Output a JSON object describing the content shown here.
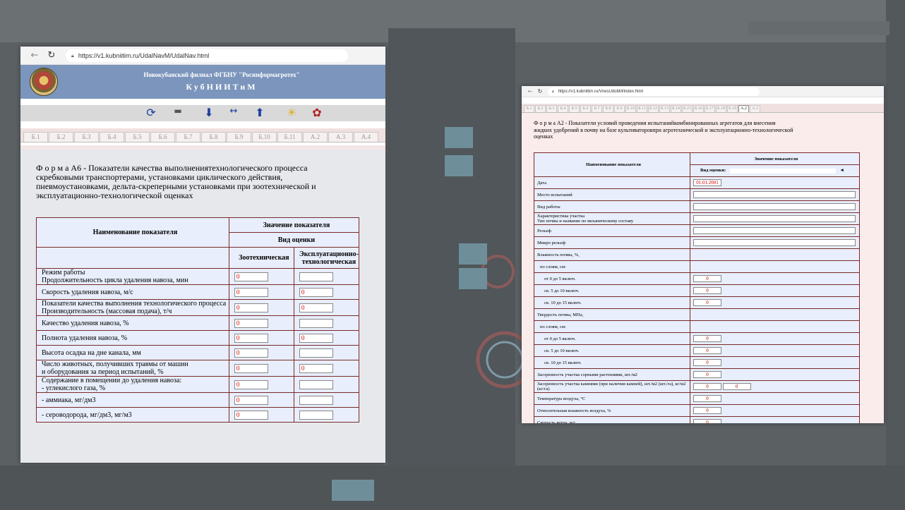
{
  "window_left": {
    "url": "https://v1.kubniitim.ru/UdalNavM/UdalNav.html",
    "header_line1": "Новокубанский филиал ФГБНУ \"Росинформагротех\"",
    "header_line2": "КубНИИТиМ",
    "tabs": [
      "Б.1",
      "Б.2",
      "Б.3",
      "Б.4",
      "Б.5",
      "Б.6",
      "Б.7",
      "Б.8",
      "Б.9",
      "Б.10",
      "Б.11",
      "А.2",
      "А.3",
      "А.4"
    ],
    "form_title": "Ф о р м а А6 - Показатели качества выполнениятехнологического процесса скребковыми транспортерами, установками циклического действия, пневмоустановками, дельта-скреперными установками при зоотехнической и эксплуатационно-технологической оценках",
    "table": {
      "col_name": "Наименование показателя",
      "col_value": "Значение показателя",
      "col_type": "Вид оценки",
      "col_zoo": "Зоотехническая",
      "col_expl": "Эксплуатационно-технологическая",
      "rows": [
        {
          "label": "Режим работы\nПродолжительность цикла удаления навоза, мин",
          "zoo": "0",
          "expl": ""
        },
        {
          "label": "Скорость удаления навоза, м/с",
          "zoo": "0",
          "expl": "0"
        },
        {
          "label": "Показатели качества выполнения технологического процесса\nПроизводительность (массовая подача), т/ч",
          "zoo": "0",
          "expl": "0"
        },
        {
          "label": "Качество удаления навоза, %",
          "zoo": "0",
          "expl": ""
        },
        {
          "label": "Полнота удаления навоза, %",
          "zoo": "0",
          "expl": "0"
        },
        {
          "label": "Высота осадка на дне канала, мм",
          "zoo": "0",
          "expl": ""
        },
        {
          "label": "Число животных, получивших травмы от машин\nи оборудования за период испытаний, %",
          "zoo": "0",
          "expl": "0"
        },
        {
          "label": "Содержание в помещении до удаления навоза:\n - углекислого газа, %",
          "zoo": "0",
          "expl": ""
        },
        {
          "label": " - аммиака, мг/дм3",
          "zoo": "0",
          "expl": ""
        },
        {
          "label": " - сероводорода, мг/дм3, мг/м3",
          "zoo": "0",
          "expl": ""
        }
      ]
    }
  },
  "window_right": {
    "url": "https://v1.kubniitim.ru/VnesUdobM/index.html",
    "tabs": [
      "Б.1",
      "Б.2",
      "Б.3",
      "Б.4",
      "Б.5",
      "Б.6",
      "Б.7",
      "Б.8",
      "Б.9",
      "Б.10",
      "Б.11",
      "Б.12",
      "Б.13",
      "Б.14",
      "Б.15",
      "Б.16",
      "Б.17",
      "Б.18",
      "Б.19",
      "А.2",
      "А.3"
    ],
    "form_title": "Ф о р м а А2 - Показатели условий проведения испытанийкомбинированных агрегатов для внесения жидких удобрений в почву на базе культиваторовпри агротехнической и эксплуатационно-технологической оценках",
    "table": {
      "col_name": "Наименование показателя",
      "col_value": "Значение показателя",
      "col_type": "Вид оценки:",
      "select_arrow": "◄",
      "rows": [
        {
          "label": "Дата",
          "value": "01.01.2001",
          "kind": "date"
        },
        {
          "label": "Место испытаний",
          "value": "",
          "kind": "wide"
        },
        {
          "label": "Вид работы",
          "value": "",
          "kind": "wide"
        },
        {
          "label": "Характеристика участка\nТип почвы и название по механическому составу",
          "value": "",
          "kind": "wide"
        },
        {
          "label": "Рельеф",
          "value": "",
          "kind": "wide"
        },
        {
          "label": "Микро рельеф",
          "value": "",
          "kind": "wide"
        },
        {
          "label": "Влажность почвы, %,",
          "value": "",
          "kind": "none"
        },
        {
          "label": "по слоям, см:",
          "value": "",
          "kind": "none"
        },
        {
          "label": "от 0 до 5 включ.",
          "value": "0",
          "kind": "num"
        },
        {
          "label": "св. 5 до 10 включ.",
          "value": "0",
          "kind": "num"
        },
        {
          "label": "св. 10 до 15 включ.",
          "value": "0",
          "kind": "num"
        },
        {
          "label": "Твердость почвы, МПа,",
          "value": "",
          "kind": "none"
        },
        {
          "label": "по слоям, см:",
          "value": "",
          "kind": "none"
        },
        {
          "label": "от 0 до 5 включ.",
          "value": "0",
          "kind": "num"
        },
        {
          "label": "св. 5 до 10 включ.",
          "value": "0",
          "kind": "num"
        },
        {
          "label": "св. 10 до 15 включ.",
          "value": "0",
          "kind": "num"
        },
        {
          "label": "Засоренность участка сорными растениями, шт./м2",
          "value": "0",
          "kind": "num"
        },
        {
          "label": "Засоренность участка камнями (при наличии камней), шт./м2 (шт./га), кг/м2 (кг/га)",
          "value": "0",
          "value2": "0",
          "kind": "num2"
        },
        {
          "label": "Температура воздуха, °С",
          "value": "0",
          "kind": "num"
        },
        {
          "label": "Относительная влажность воздуха, %",
          "value": "0",
          "kind": "num"
        },
        {
          "label": "Скорость ветра, м/с",
          "value": "0",
          "kind": "num"
        }
      ]
    }
  },
  "nav_icons": [
    "back-arrow-icon",
    "reload-icon",
    "lock-icon"
  ],
  "toolbar_icons": [
    "refresh-icon",
    "car-icon",
    "down-arrow-icon",
    "left-right-icon",
    "up-arrow-icon",
    "sun-icon",
    "settings-icon"
  ]
}
